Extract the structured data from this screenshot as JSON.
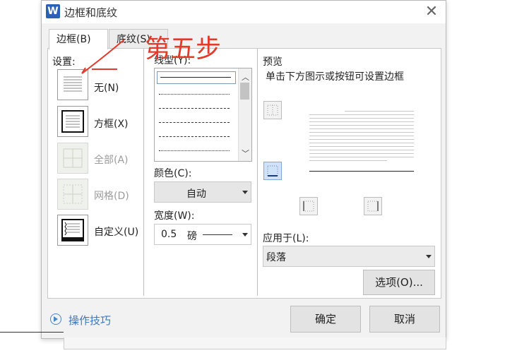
{
  "dialog": {
    "title": "边框和底纹",
    "app_icon_letter": "W"
  },
  "tabs": [
    {
      "label": "边框(B)"
    },
    {
      "label": "底纹(S)"
    }
  ],
  "settings": {
    "heading": "设置:",
    "items": [
      {
        "label": "无(N)"
      },
      {
        "label": "方框(X)"
      },
      {
        "label": "全部(A)"
      },
      {
        "label": "网格(D)"
      },
      {
        "label": "自定义(U)"
      }
    ]
  },
  "line_style": {
    "heading": "线型(Y):"
  },
  "color": {
    "label": "颜色(C):",
    "value": "自动"
  },
  "width": {
    "label": "宽度(W):",
    "value": "0.5",
    "unit": "磅"
  },
  "preview": {
    "heading": "预览",
    "hint": "单击下方图示或按钮可设置边框"
  },
  "apply_to": {
    "label": "应用于(L):",
    "value": "段落"
  },
  "buttons": {
    "options": "选项(O)...",
    "ok": "确定",
    "cancel": "取消",
    "tips": "操作技巧"
  },
  "annotation": {
    "text": "第五步",
    "color": "#e23b2a"
  },
  "colors": {
    "accent": "#2b5fb8",
    "selected_preview": "#cfe2f7"
  }
}
